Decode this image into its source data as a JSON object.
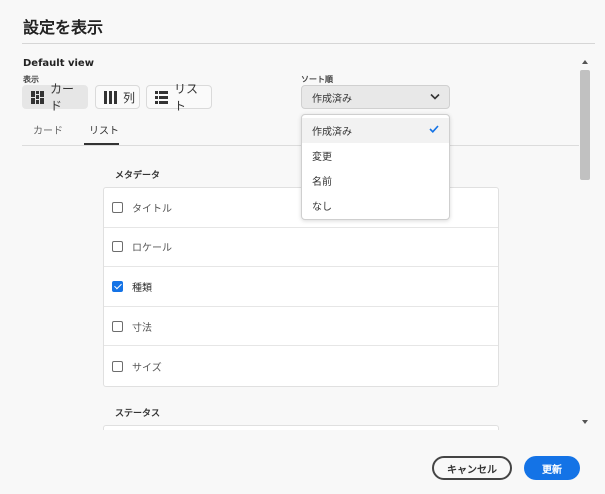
{
  "dialog": {
    "title": "設定を表示"
  },
  "default_view": {
    "heading": "Default view",
    "display_label": "表示",
    "view_options": [
      {
        "label": "カード",
        "icon": "grid-icon",
        "selected": true
      },
      {
        "label": "列",
        "icon": "columns-icon",
        "selected": false
      },
      {
        "label": "リスト",
        "icon": "list-icon",
        "selected": false
      }
    ]
  },
  "sort": {
    "label": "ソート順",
    "value": "作成済み",
    "options": [
      {
        "label": "作成済み",
        "selected": true
      },
      {
        "label": "変更",
        "selected": false
      },
      {
        "label": "名前",
        "selected": false
      },
      {
        "label": "なし",
        "selected": false
      }
    ]
  },
  "tabs": [
    {
      "label": "カード",
      "active": false
    },
    {
      "label": "リスト",
      "active": true
    }
  ],
  "metadata": {
    "heading": "メタデータ",
    "items": [
      {
        "label": "タイトル",
        "checked": false
      },
      {
        "label": "ロケール",
        "checked": false
      },
      {
        "label": "種類",
        "checked": true
      },
      {
        "label": "寸法",
        "checked": false
      },
      {
        "label": "サイズ",
        "checked": false
      }
    ]
  },
  "status": {
    "heading": "ステータス"
  },
  "footer": {
    "cancel_label": "キャンセル",
    "update_label": "更新"
  },
  "colors": {
    "accent": "#1473e6",
    "background": "#f8f8f8"
  }
}
